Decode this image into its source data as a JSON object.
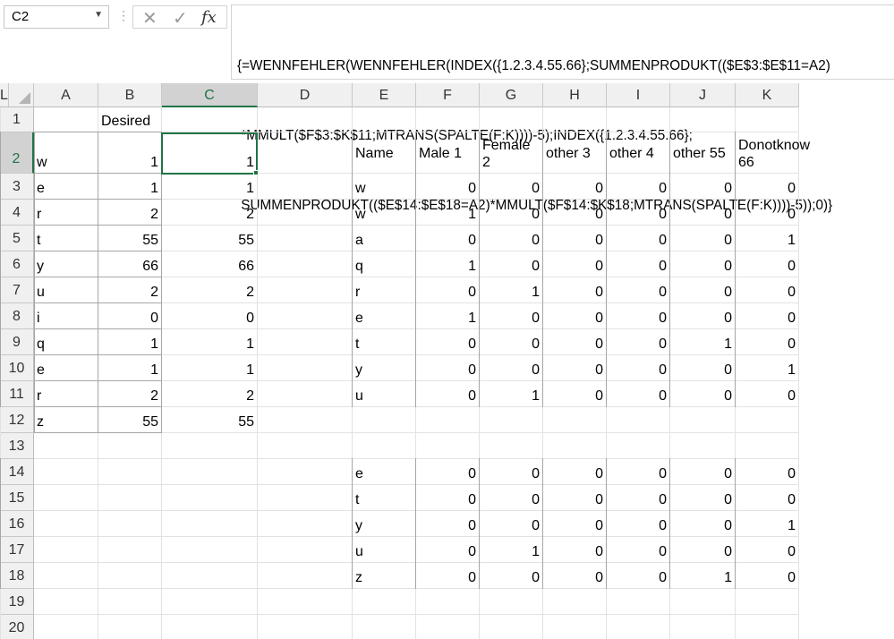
{
  "formula_bar": {
    "name_box": "C2",
    "formula_lines": [
      "{=WENNFEHLER(WENNFEHLER(INDEX({1.2.3.4.55.66};SUMMENPRODUKT(($E$3:$E$11=A2)",
      " *MMULT($F$3:$K$11;MTRANS(SPALTE(F:K))))-5);INDEX({1.2.3.4.55.66};",
      " SUMMENPRODUKT(($E$14:$E$18=A2)*MMULT($F$14:$K$18;MTRANS(SPALTE(F:K))))-5));0)}"
    ],
    "cancel_glyph": "✕",
    "enter_glyph": "✓",
    "insert_function_glyph": "fx"
  },
  "columns": [
    "A",
    "B",
    "C",
    "D",
    "E",
    "F",
    "G",
    "H",
    "I",
    "J",
    "K",
    "L"
  ],
  "selected_column": "C",
  "rows": [
    "1",
    "2",
    "3",
    "4",
    "5",
    "6",
    "7",
    "8",
    "9",
    "10",
    "11",
    "12",
    "13",
    "14",
    "15",
    "16",
    "17",
    "18",
    "19",
    "20"
  ],
  "selected_row": "2",
  "left_table": {
    "header_b": "Desired",
    "a": [
      "w",
      "e",
      "r",
      "t",
      "y",
      "u",
      "i",
      "q",
      "e",
      "r",
      "z"
    ],
    "b": [
      "1",
      "1",
      "2",
      "55",
      "66",
      "2",
      "0",
      "1",
      "1",
      "2",
      "55"
    ],
    "c": [
      "1",
      "1",
      "2",
      "55",
      "66",
      "2",
      "0",
      "1",
      "1",
      "2",
      "55"
    ]
  },
  "right_table": {
    "headers": [
      "Name",
      "Male 1",
      "Female\n2",
      "other 3",
      "other 4",
      "other 55",
      "Donotknow\n66"
    ],
    "rows": [
      [
        "w",
        "0",
        "0",
        "0",
        "0",
        "0",
        "0"
      ],
      [
        "w",
        "1",
        "0",
        "0",
        "0",
        "0",
        "0"
      ],
      [
        "a",
        "0",
        "0",
        "0",
        "0",
        "0",
        "1"
      ],
      [
        "q",
        "1",
        "0",
        "0",
        "0",
        "0",
        "0"
      ],
      [
        "r",
        "0",
        "1",
        "0",
        "0",
        "0",
        "0"
      ],
      [
        "e",
        "1",
        "0",
        "0",
        "0",
        "0",
        "0"
      ],
      [
        "t",
        "0",
        "0",
        "0",
        "0",
        "1",
        "0"
      ],
      [
        "y",
        "0",
        "0",
        "0",
        "0",
        "0",
        "1"
      ],
      [
        "u",
        "0",
        "1",
        "0",
        "0",
        "0",
        "0"
      ]
    ]
  },
  "lower_table": {
    "rows": [
      [
        "e",
        "0",
        "0",
        "0",
        "0",
        "0",
        "0"
      ],
      [
        "t",
        "0",
        "0",
        "0",
        "0",
        "0",
        "0"
      ],
      [
        "y",
        "0",
        "0",
        "0",
        "0",
        "0",
        "1"
      ],
      [
        "u",
        "0",
        "1",
        "0",
        "0",
        "0",
        "0"
      ],
      [
        "z",
        "0",
        "0",
        "0",
        "0",
        "1",
        "0"
      ]
    ]
  }
}
